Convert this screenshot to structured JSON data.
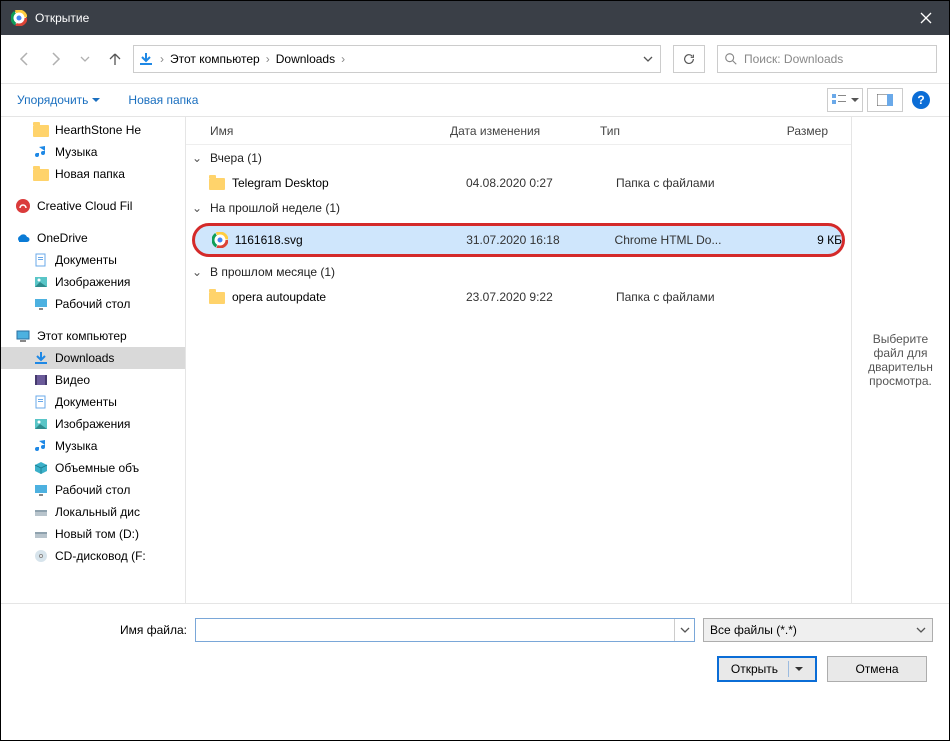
{
  "window": {
    "title": "Открытие"
  },
  "nav": {
    "breadcrumb": [
      "Этот компьютер",
      "Downloads"
    ],
    "search_placeholder": "Поиск: Downloads"
  },
  "cmdbar": {
    "organize": "Упорядочить",
    "newfolder": "Новая папка"
  },
  "columns": {
    "name": "Имя",
    "date": "Дата изменения",
    "type": "Тип",
    "size": "Размер"
  },
  "tree": {
    "items0": [
      "HearthStone  He",
      "Музыка",
      "Новая папка"
    ],
    "cc": "Creative Cloud Fil",
    "onedrive": "OneDrive",
    "od_items": [
      "Документы",
      "Изображения",
      "Рабочий стол"
    ],
    "thispc": "Этот компьютер",
    "pc_items": [
      "Downloads",
      "Видео",
      "Документы",
      "Изображения",
      "Музыка",
      "Объемные объ",
      "Рабочий стол",
      "Локальный дис",
      "Новый том (D:)",
      "CD-дисковод (F:"
    ]
  },
  "groups": [
    {
      "title": "Вчера (1)",
      "rows": [
        {
          "name": "Telegram Desktop",
          "date": "04.08.2020 0:27",
          "type": "Папка с файлами",
          "size": "",
          "icon": "folder"
        }
      ]
    },
    {
      "title": "На прошлой неделе (1)",
      "rows": [
        {
          "name": "1161618.svg",
          "date": "31.07.2020 16:18",
          "type": "Chrome HTML Do...",
          "size": "9 КБ",
          "icon": "chrome",
          "selected": true
        }
      ]
    },
    {
      "title": "В прошлом месяце (1)",
      "rows": [
        {
          "name": "opera autoupdate",
          "date": "23.07.2020 9:22",
          "type": "Папка с файлами",
          "size": "",
          "icon": "folder"
        }
      ]
    }
  ],
  "preview": {
    "text": "Выберите файл для дварительн просмотра."
  },
  "bottom": {
    "filename_label": "Имя файла:",
    "filename_value": "",
    "filter": "Все файлы (*.*)",
    "open": "Открыть",
    "cancel": "Отмена"
  }
}
